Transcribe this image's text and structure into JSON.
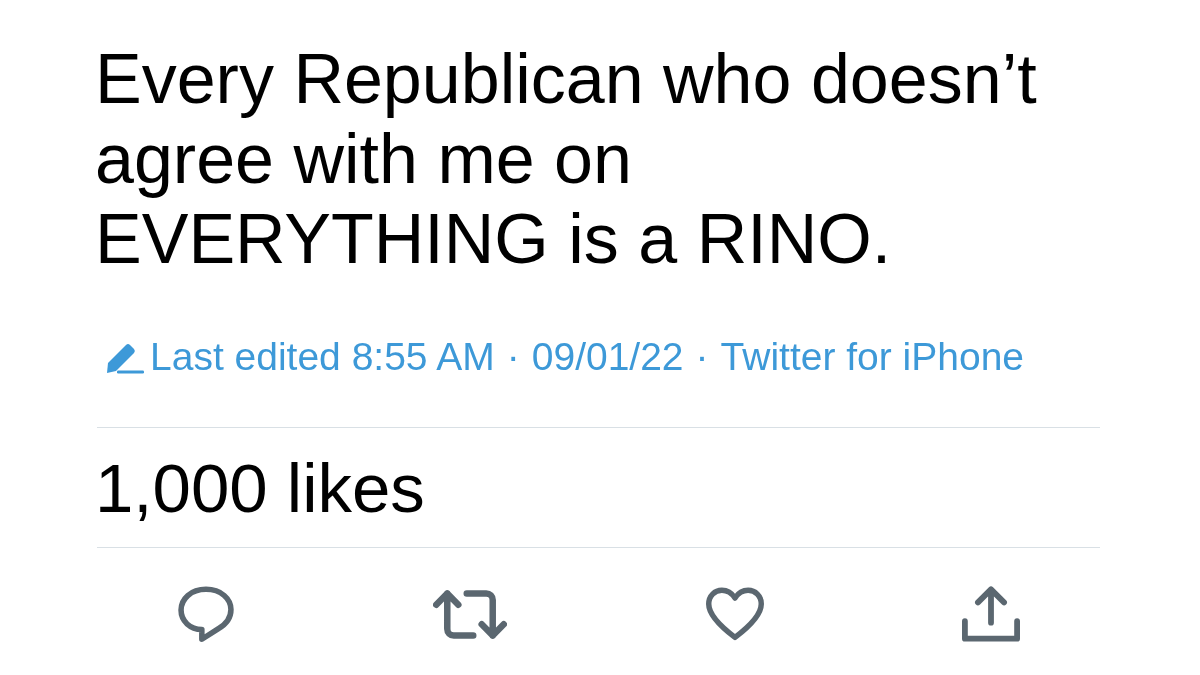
{
  "tweet": {
    "text": "Every Republican who doesn’t agree with me on EVERYTHING is a RINO."
  },
  "meta": [
    {
      "kind": "edited",
      "text": "Last edited 8:55 AM"
    },
    {
      "kind": "separator",
      "text": "·"
    },
    {
      "kind": "link",
      "text": "09/01/22"
    },
    {
      "kind": "separator",
      "text": "·"
    },
    {
      "kind": "link",
      "text": "Twitter for iPhone"
    }
  ],
  "likes": {
    "text": "1,000 likes"
  },
  "actions": [
    {
      "kind": "reply"
    },
    {
      "kind": "retweet"
    },
    {
      "kind": "like"
    },
    {
      "kind": "share"
    }
  ]
}
